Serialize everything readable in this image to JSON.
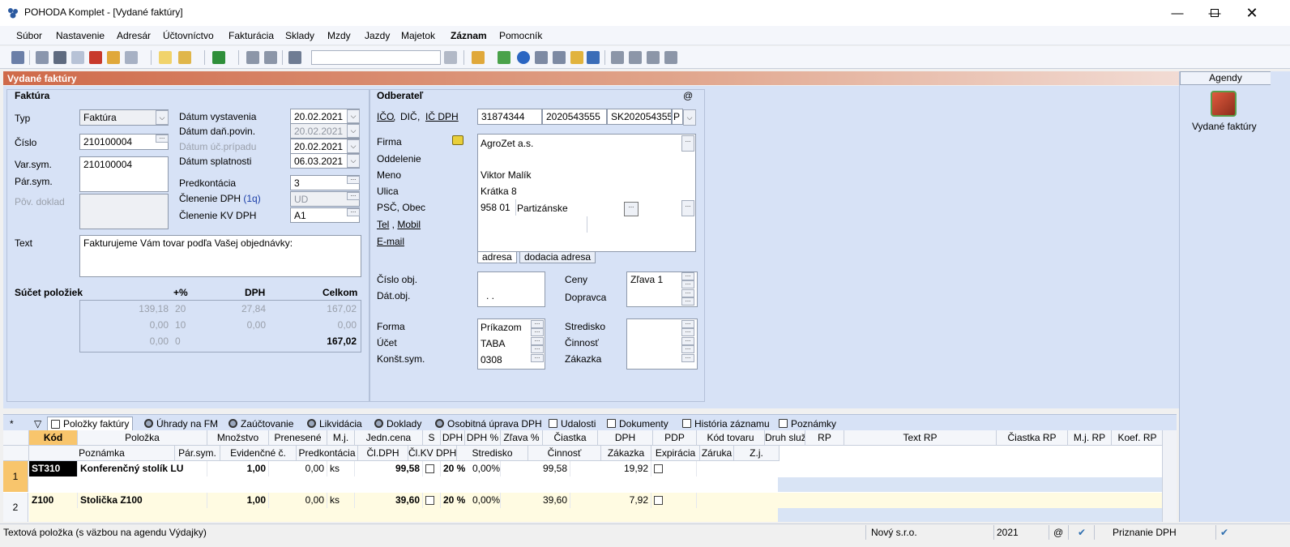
{
  "window": {
    "title": "POHODA Komplet - [Vydané faktúry]"
  },
  "menu": [
    "Súbor",
    "Nastavenie",
    "Adresár",
    "Účtovníctvo",
    "Fakturácia",
    "Sklady",
    "Mzdy",
    "Jazdy",
    "Majetok",
    "Záznam",
    "Pomocník"
  ],
  "agenda": {
    "title": "Vydané faktúry"
  },
  "invoice": {
    "section": "Faktúra",
    "typ_label": "Typ",
    "typ_value": "Faktúra",
    "cislo_label": "Číslo",
    "cislo_value": "210100004",
    "varsym_label": "Var.sym.",
    "varsym_value": "210100004",
    "parsym_label": "Pár.sym.",
    "povdoklad_label": "Pôv. doklad",
    "datum_vystavenia_label": "Dátum vystavenia",
    "datum_vystavenia": "20.02.2021",
    "datum_dan_label": "Dátum daň.povin.",
    "datum_dan": "20.02.2021",
    "datum_uc_label": "Dátum úč.prípadu",
    "datum_uc": "20.02.2021",
    "datum_splatnosti_label": "Dátum splatnosti",
    "datum_splatnosti": "06.03.2021",
    "predkontacia_label": "Predkontácia",
    "predkontacia": "3",
    "clenenie_dph_label": "Členenie DPH",
    "clenenie_dph_link": "(1q)",
    "clenenie_dph": "UD",
    "clenenie_kv_label": "Členenie KV DPH",
    "clenenie_kv": "A1",
    "text_label": "Text",
    "text_value": "Fakturujeme Vám tovar podľa Vašej objednávky:"
  },
  "summary": {
    "title": "Súčet položiek",
    "headers": [
      "+%",
      "DPH",
      "Celkom"
    ],
    "rows": [
      {
        "base": "139,18",
        "rate": "20",
        "dph": "27,84",
        "total": "167,02"
      },
      {
        "base": "0,00",
        "rate": "10",
        "dph": "0,00",
        "total": "0,00"
      },
      {
        "base": "0,00",
        "rate": "0",
        "dph": "",
        "total": "167,02"
      }
    ]
  },
  "customer": {
    "section": "Odberateľ",
    "at": "@",
    "ico_label": "IČO",
    "dic_label": "DIČ",
    "icdph_label": "IČ DPH",
    "ico": "31874344",
    "dic": "2020543555",
    "icdph": "SK2020543555",
    "p": "P",
    "firma_label": "Firma",
    "oddelenie_label": "Oddelenie",
    "meno_label": "Meno",
    "ulica_label": "Ulica",
    "psc_label": "PSČ, Obec",
    "tel_label": "Tel",
    "mobil_label": "Mobil",
    "email_label": "E-mail",
    "firma": "AgroZet a.s.",
    "meno": "Viktor Malík",
    "ulica": "Krátka 8",
    "psc": "958 01",
    "obec": "Partizánske",
    "tab_adresa": "adresa",
    "tab_dodacia": "dodacia adresa",
    "cislo_obj_label": "Číslo obj.",
    "dat_obj_label": "Dát.obj.",
    "dat_obj": ". .",
    "ceny_label": "Ceny",
    "ceny": "Zľava 1",
    "dopravca_label": "Dopravca",
    "forma_label": "Forma",
    "forma": "Príkazom",
    "ucet_label": "Účet",
    "ucet": "TABA",
    "konst_label": "Konšt.sym.",
    "konst": "0308",
    "stredisko_label": "Stredisko",
    "cinnost_label": "Činnosť",
    "zakazka_label": "Zákazka"
  },
  "right_pane": {
    "header": "Agendy",
    "item": "Vydané faktúry"
  },
  "tabs": [
    "*",
    "Položky faktúry",
    "Úhrady na FM",
    "Zaúčtovanie",
    "Likvidácia",
    "Doklady",
    "Osobitná úprava DPH",
    "Udalosti",
    "Dokumenty",
    "História záznamu",
    "Poznámky"
  ],
  "grid": {
    "header1": [
      "Kód",
      "Položka",
      "Množstvo",
      "Prenesené",
      "M.j.",
      "Jedn.cena",
      "S",
      "DPH",
      "DPH %",
      "Zľava %",
      "Čiastka",
      "DPH",
      "PDP",
      "Kód tovaru",
      "Druh služ",
      "RP",
      "Text RP",
      "Čiastka RP",
      "M.j. RP",
      "Koef. RP"
    ],
    "header2": [
      "Poznámka",
      "Pár.sym.",
      "Evidenčné č.",
      "Predkontácia",
      "Čl.DPH",
      "Čl.KV DPH",
      "Stredisko",
      "Činnosť",
      "Zákazka",
      "Expirácia",
      "Záruka",
      "Z.j."
    ],
    "rows": [
      {
        "no": "1",
        "kod": "ST310",
        "polozka": "Konferenčný stolík LU",
        "mnozstvo": "1,00",
        "prenesene": "0,00",
        "mj": "ks",
        "cena": "99,58",
        "dph": "20 %",
        "zlava": "0,00%",
        "ciastka": "99,58",
        "dph_val": "19,92"
      },
      {
        "no": "2",
        "kod": "Z100",
        "polozka": "Stolička Z100",
        "mnozstvo": "1,00",
        "prenesene": "0,00",
        "mj": "ks",
        "cena": "39,60",
        "dph": "20 %",
        "zlava": "0,00%",
        "ciastka": "39,60",
        "dph_val": "7,92"
      }
    ]
  },
  "status": {
    "text": "Textová položka (s väzbou na agendu Výdajky)",
    "company": "Nový s.r.o.",
    "year": "2021",
    "at": "@",
    "vat": "Priznanie DPH"
  }
}
